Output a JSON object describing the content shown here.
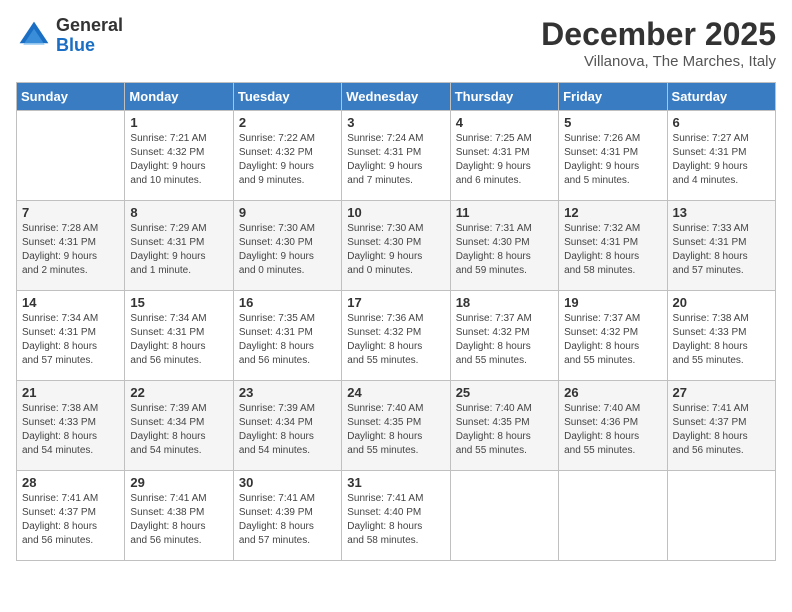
{
  "header": {
    "logo_general": "General",
    "logo_blue": "Blue",
    "month_title": "December 2025",
    "location": "Villanova, The Marches, Italy"
  },
  "weekdays": [
    "Sunday",
    "Monday",
    "Tuesday",
    "Wednesday",
    "Thursday",
    "Friday",
    "Saturday"
  ],
  "weeks": [
    [
      {
        "day": "",
        "info": ""
      },
      {
        "day": "1",
        "info": "Sunrise: 7:21 AM\nSunset: 4:32 PM\nDaylight: 9 hours\nand 10 minutes."
      },
      {
        "day": "2",
        "info": "Sunrise: 7:22 AM\nSunset: 4:32 PM\nDaylight: 9 hours\nand 9 minutes."
      },
      {
        "day": "3",
        "info": "Sunrise: 7:24 AM\nSunset: 4:31 PM\nDaylight: 9 hours\nand 7 minutes."
      },
      {
        "day": "4",
        "info": "Sunrise: 7:25 AM\nSunset: 4:31 PM\nDaylight: 9 hours\nand 6 minutes."
      },
      {
        "day": "5",
        "info": "Sunrise: 7:26 AM\nSunset: 4:31 PM\nDaylight: 9 hours\nand 5 minutes."
      },
      {
        "day": "6",
        "info": "Sunrise: 7:27 AM\nSunset: 4:31 PM\nDaylight: 9 hours\nand 4 minutes."
      }
    ],
    [
      {
        "day": "7",
        "info": "Sunrise: 7:28 AM\nSunset: 4:31 PM\nDaylight: 9 hours\nand 2 minutes."
      },
      {
        "day": "8",
        "info": "Sunrise: 7:29 AM\nSunset: 4:31 PM\nDaylight: 9 hours\nand 1 minute."
      },
      {
        "day": "9",
        "info": "Sunrise: 7:30 AM\nSunset: 4:30 PM\nDaylight: 9 hours\nand 0 minutes."
      },
      {
        "day": "10",
        "info": "Sunrise: 7:30 AM\nSunset: 4:30 PM\nDaylight: 9 hours\nand 0 minutes."
      },
      {
        "day": "11",
        "info": "Sunrise: 7:31 AM\nSunset: 4:30 PM\nDaylight: 8 hours\nand 59 minutes."
      },
      {
        "day": "12",
        "info": "Sunrise: 7:32 AM\nSunset: 4:31 PM\nDaylight: 8 hours\nand 58 minutes."
      },
      {
        "day": "13",
        "info": "Sunrise: 7:33 AM\nSunset: 4:31 PM\nDaylight: 8 hours\nand 57 minutes."
      }
    ],
    [
      {
        "day": "14",
        "info": "Sunrise: 7:34 AM\nSunset: 4:31 PM\nDaylight: 8 hours\nand 57 minutes."
      },
      {
        "day": "15",
        "info": "Sunrise: 7:34 AM\nSunset: 4:31 PM\nDaylight: 8 hours\nand 56 minutes."
      },
      {
        "day": "16",
        "info": "Sunrise: 7:35 AM\nSunset: 4:31 PM\nDaylight: 8 hours\nand 56 minutes."
      },
      {
        "day": "17",
        "info": "Sunrise: 7:36 AM\nSunset: 4:32 PM\nDaylight: 8 hours\nand 55 minutes."
      },
      {
        "day": "18",
        "info": "Sunrise: 7:37 AM\nSunset: 4:32 PM\nDaylight: 8 hours\nand 55 minutes."
      },
      {
        "day": "19",
        "info": "Sunrise: 7:37 AM\nSunset: 4:32 PM\nDaylight: 8 hours\nand 55 minutes."
      },
      {
        "day": "20",
        "info": "Sunrise: 7:38 AM\nSunset: 4:33 PM\nDaylight: 8 hours\nand 55 minutes."
      }
    ],
    [
      {
        "day": "21",
        "info": "Sunrise: 7:38 AM\nSunset: 4:33 PM\nDaylight: 8 hours\nand 54 minutes."
      },
      {
        "day": "22",
        "info": "Sunrise: 7:39 AM\nSunset: 4:34 PM\nDaylight: 8 hours\nand 54 minutes."
      },
      {
        "day": "23",
        "info": "Sunrise: 7:39 AM\nSunset: 4:34 PM\nDaylight: 8 hours\nand 54 minutes."
      },
      {
        "day": "24",
        "info": "Sunrise: 7:40 AM\nSunset: 4:35 PM\nDaylight: 8 hours\nand 55 minutes."
      },
      {
        "day": "25",
        "info": "Sunrise: 7:40 AM\nSunset: 4:35 PM\nDaylight: 8 hours\nand 55 minutes."
      },
      {
        "day": "26",
        "info": "Sunrise: 7:40 AM\nSunset: 4:36 PM\nDaylight: 8 hours\nand 55 minutes."
      },
      {
        "day": "27",
        "info": "Sunrise: 7:41 AM\nSunset: 4:37 PM\nDaylight: 8 hours\nand 56 minutes."
      }
    ],
    [
      {
        "day": "28",
        "info": "Sunrise: 7:41 AM\nSunset: 4:37 PM\nDaylight: 8 hours\nand 56 minutes."
      },
      {
        "day": "29",
        "info": "Sunrise: 7:41 AM\nSunset: 4:38 PM\nDaylight: 8 hours\nand 56 minutes."
      },
      {
        "day": "30",
        "info": "Sunrise: 7:41 AM\nSunset: 4:39 PM\nDaylight: 8 hours\nand 57 minutes."
      },
      {
        "day": "31",
        "info": "Sunrise: 7:41 AM\nSunset: 4:40 PM\nDaylight: 8 hours\nand 58 minutes."
      },
      {
        "day": "",
        "info": ""
      },
      {
        "day": "",
        "info": ""
      },
      {
        "day": "",
        "info": ""
      }
    ]
  ]
}
